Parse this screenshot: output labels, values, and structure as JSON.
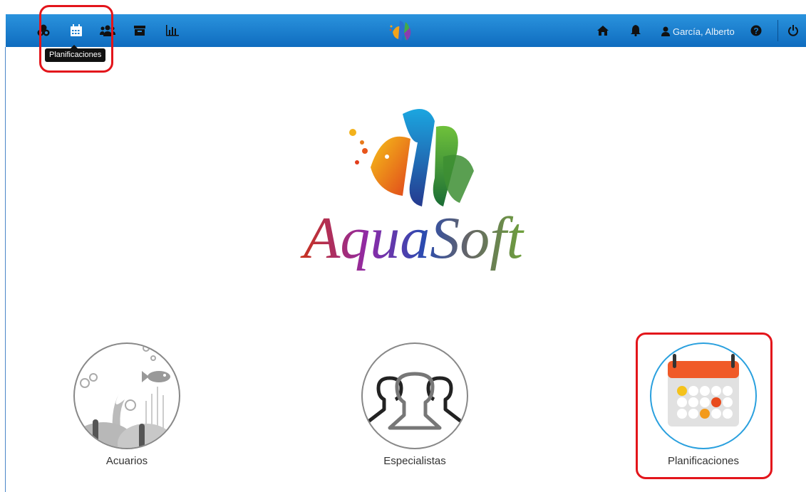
{
  "app": {
    "name": "AquaSoft"
  },
  "topbar": {
    "left_icons": [
      {
        "icon": "molecules-icon"
      },
      {
        "icon": "calendar-icon"
      },
      {
        "icon": "users-icon"
      },
      {
        "icon": "archive-icon"
      },
      {
        "icon": "bar-chart-icon"
      }
    ],
    "right_icons": [
      {
        "icon": "home-icon"
      },
      {
        "icon": "bell-icon"
      },
      {
        "icon": "user-icon"
      },
      {
        "icon": "help-icon"
      },
      {
        "icon": "power-icon"
      }
    ],
    "user_name": "García, Alberto",
    "tooltip": "Planificaciones"
  },
  "logo": {
    "text": "AquaSoft"
  },
  "cards": [
    {
      "label": "Acuarios",
      "icon": "aquarium-icon"
    },
    {
      "label": "Especialistas",
      "icon": "specialists-icon"
    },
    {
      "label": "Planificaciones",
      "icon": "calendar-planning-icon"
    }
  ],
  "colors": {
    "topbar": "#1a7fd0",
    "highlight": "#e3151b",
    "calendar_header": "#f05a28",
    "selected_ring": "#2aa0de"
  }
}
